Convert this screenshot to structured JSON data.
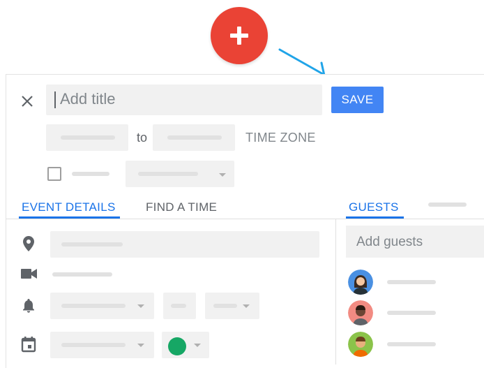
{
  "fab": {
    "icon": "plus-icon",
    "color": "#ea4335"
  },
  "annotation": {
    "icon": "arrow-icon",
    "color": "#20a4e8"
  },
  "header": {
    "close_icon": "close-icon",
    "title_placeholder": "Add title",
    "save_label": "SAVE",
    "save_color": "#4285f4"
  },
  "datetime": {
    "to_label": "to",
    "timezone_label": "TIME ZONE"
  },
  "tabs": {
    "event_details": "EVENT DETAILS",
    "find_a_time": "FIND A TIME",
    "guests": "GUESTS",
    "active_color": "#1a73e8"
  },
  "details": {
    "location_icon": "location-pin-icon",
    "video_icon": "video-camera-icon",
    "notification_icon": "bell-icon",
    "calendar_icon": "calendar-icon",
    "event_color": "#16a765"
  },
  "guests": {
    "placeholder": "Add guests",
    "avatars": [
      {
        "name": "avatar-woman",
        "bg": "#4a90e2"
      },
      {
        "name": "avatar-man-dark",
        "bg": "#f28b82"
      },
      {
        "name": "avatar-man-light",
        "bg": "#8bc34a"
      }
    ]
  }
}
